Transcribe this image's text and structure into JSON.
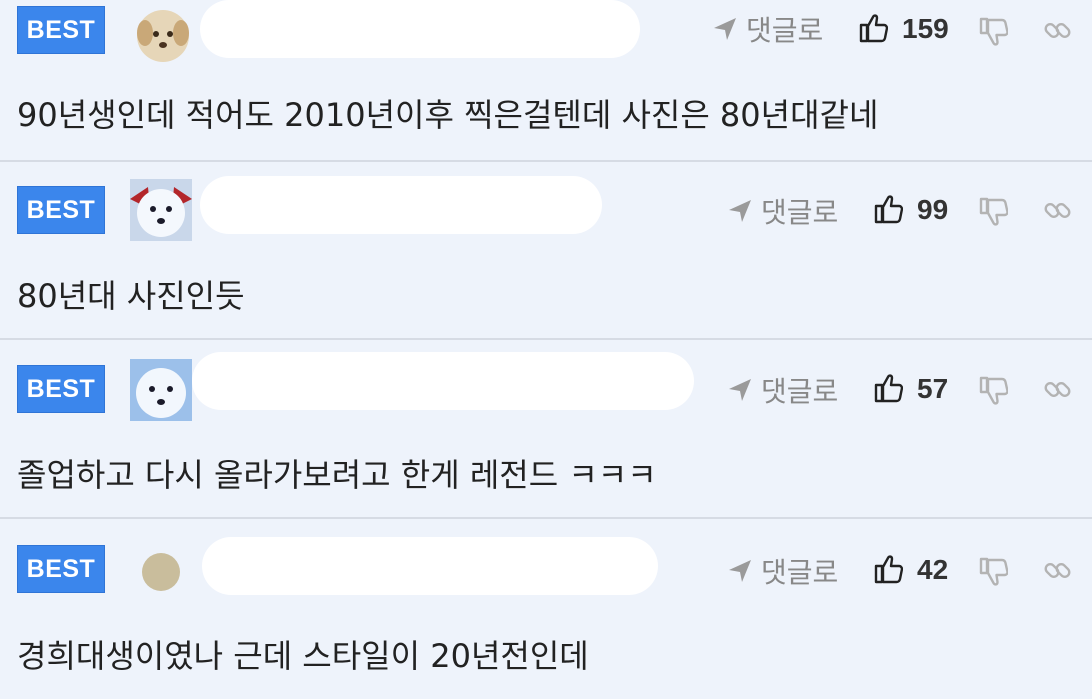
{
  "comments": [
    {
      "badge": "BEST",
      "avatar": "puppy-avatar",
      "reply_label": "댓글로",
      "likes": "159",
      "text": "90년생인데 적어도 2010년이후 찍은걸텐데 사진은 80년대같네"
    },
    {
      "badge": "BEST",
      "avatar": "white-dog-avatar",
      "reply_label": "댓글로",
      "likes": "99",
      "text": "80년대 사진인듯"
    },
    {
      "badge": "BEST",
      "avatar": "white-dog-avatar",
      "reply_label": "댓글로",
      "likes": "57",
      "text": "졸업하고 다시 올라가보려고 한게 레전드 ㅋㅋㅋ"
    },
    {
      "badge": "BEST",
      "avatar": "default-circle-avatar",
      "reply_label": "댓글로",
      "likes": "42",
      "text": "경희대생이였나 근데 스타일이 20년전인데"
    }
  ],
  "icons": {
    "reply": "reply-arrow-icon",
    "like": "thumbs-up-icon",
    "dislike": "thumbs-down-icon",
    "link": "link-icon"
  },
  "colors": {
    "badge": "#3b86ec",
    "background": "#eef3fb",
    "divider": "#d6dbe4"
  }
}
